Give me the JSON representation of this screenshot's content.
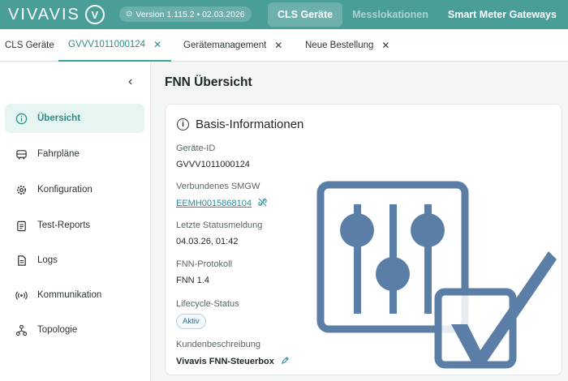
{
  "header": {
    "logo_text": "VIVAVIS",
    "logo_mark": "V",
    "version": "Version 1.115.2 • 02.03.2026",
    "nav": [
      {
        "label": "CLS Geräte"
      },
      {
        "label": "Messlokationen"
      },
      {
        "label": "Smart Meter Gateways"
      }
    ]
  },
  "tabs": [
    {
      "label": "CLS Geräte",
      "closable": false
    },
    {
      "label": "GVVV1011000124",
      "closable": true
    },
    {
      "label": "Gerätemanagement",
      "closable": true
    },
    {
      "label": "Neue Bestellung",
      "closable": true
    }
  ],
  "sidebar": {
    "collapse_icon": "chevron-left-icon",
    "items": [
      {
        "label": "Übersicht",
        "icon": "info-icon"
      },
      {
        "label": "Fahrpläne",
        "icon": "bus-icon"
      },
      {
        "label": "Konfiguration",
        "icon": "gear-icon"
      },
      {
        "label": "Test-Reports",
        "icon": "report-icon"
      },
      {
        "label": "Logs",
        "icon": "document-icon"
      },
      {
        "label": "Kommunikation",
        "icon": "broadcast-icon"
      },
      {
        "label": "Topologie",
        "icon": "topology-icon"
      }
    ]
  },
  "main": {
    "title": "FNN Übersicht",
    "card_title": "Basis-Informationen",
    "fields": {
      "device_id_label": "Geräte-ID",
      "device_id_value": "GVVV1011000124",
      "smgw_label": "Verbundenes SMGW",
      "smgw_value": "EEMH0015868104",
      "status_label": "Letzte Statusmeldung",
      "status_value": "04.03.26, 01:42",
      "protocol_label": "FNN-Protokoll",
      "protocol_value": "FNN 1.4",
      "lifecycle_label": "Lifecycle-Status",
      "lifecycle_value": "Aktiv",
      "description_label": "Kundenbeschreibung",
      "description_value": "Vivavis FNN-Steuerbox"
    }
  },
  "colors": {
    "brand": "#4a9e98",
    "accent": "#2b8d86",
    "overlay": "#5b7ea6"
  }
}
